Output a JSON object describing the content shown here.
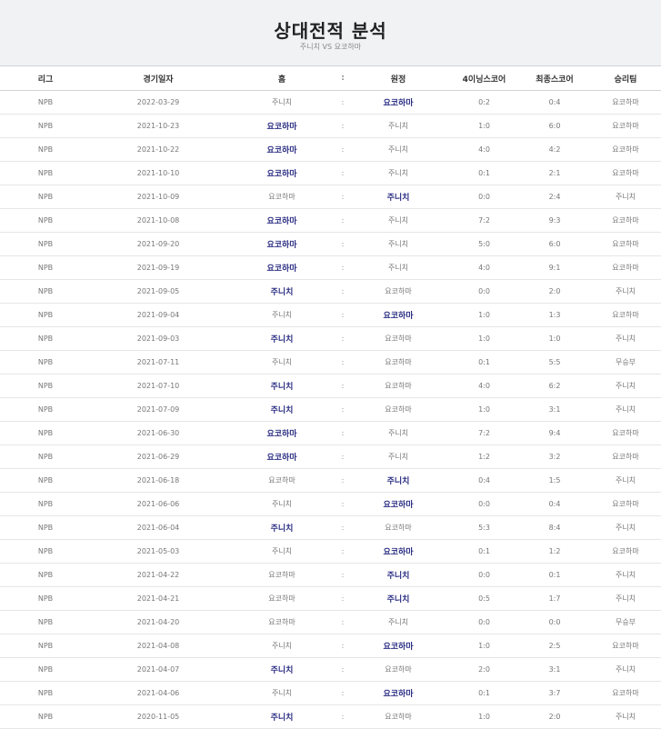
{
  "header": {
    "title": "상대전적 분석",
    "subtitle": "주니치 VS 요코하마"
  },
  "table": {
    "columns": [
      "리그",
      "경기일자",
      "홈",
      ":",
      "원정",
      "4이닝스코어",
      "최종스코어",
      "승리팀"
    ],
    "rows": [
      {
        "league": "NPB",
        "date": "2022-03-29",
        "home": "주니치",
        "sep": ":",
        "away": "요코하마",
        "inn4": "0:2",
        "final": "0:4",
        "winner": "요코하마",
        "bold": "away"
      },
      {
        "league": "NPB",
        "date": "2021-10-23",
        "home": "요코하마",
        "sep": ":",
        "away": "주니치",
        "inn4": "1:0",
        "final": "6:0",
        "winner": "요코하마",
        "bold": "home"
      },
      {
        "league": "NPB",
        "date": "2021-10-22",
        "home": "요코하마",
        "sep": ":",
        "away": "주니치",
        "inn4": "4:0",
        "final": "4:2",
        "winner": "요코하마",
        "bold": "home"
      },
      {
        "league": "NPB",
        "date": "2021-10-10",
        "home": "요코하마",
        "sep": ":",
        "away": "주니치",
        "inn4": "0:1",
        "final": "2:1",
        "winner": "요코하마",
        "bold": "home"
      },
      {
        "league": "NPB",
        "date": "2021-10-09",
        "home": "요코하마",
        "sep": ":",
        "away": "주니치",
        "inn4": "0:0",
        "final": "2:4",
        "winner": "주니치",
        "bold": "away"
      },
      {
        "league": "NPB",
        "date": "2021-10-08",
        "home": "요코하마",
        "sep": ":",
        "away": "주니치",
        "inn4": "7:2",
        "final": "9:3",
        "winner": "요코하마",
        "bold": "home"
      },
      {
        "league": "NPB",
        "date": "2021-09-20",
        "home": "요코하마",
        "sep": ":",
        "away": "주니치",
        "inn4": "5:0",
        "final": "6:0",
        "winner": "요코하마",
        "bold": "home"
      },
      {
        "league": "NPB",
        "date": "2021-09-19",
        "home": "요코하마",
        "sep": ":",
        "away": "주니치",
        "inn4": "4:0",
        "final": "9:1",
        "winner": "요코하마",
        "bold": "home"
      },
      {
        "league": "NPB",
        "date": "2021-09-05",
        "home": "주니치",
        "sep": ":",
        "away": "요코하마",
        "inn4": "0:0",
        "final": "2:0",
        "winner": "주니치",
        "bold": "home"
      },
      {
        "league": "NPB",
        "date": "2021-09-04",
        "home": "주니치",
        "sep": ":",
        "away": "요코하마",
        "inn4": "1:0",
        "final": "1:3",
        "winner": "요코하마",
        "bold": "away"
      },
      {
        "league": "NPB",
        "date": "2021-09-03",
        "home": "주니치",
        "sep": ":",
        "away": "요코하마",
        "inn4": "1:0",
        "final": "1:0",
        "winner": "주니치",
        "bold": "home"
      },
      {
        "league": "NPB",
        "date": "2021-07-11",
        "home": "주니치",
        "sep": ":",
        "away": "요코하마",
        "inn4": "0:1",
        "final": "5:5",
        "winner": "무승부",
        "bold": ""
      },
      {
        "league": "NPB",
        "date": "2021-07-10",
        "home": "주니치",
        "sep": ":",
        "away": "요코하마",
        "inn4": "4:0",
        "final": "6:2",
        "winner": "주니치",
        "bold": "home"
      },
      {
        "league": "NPB",
        "date": "2021-07-09",
        "home": "주니치",
        "sep": ":",
        "away": "요코하마",
        "inn4": "1:0",
        "final": "3:1",
        "winner": "주니치",
        "bold": "home"
      },
      {
        "league": "NPB",
        "date": "2021-06-30",
        "home": "요코하마",
        "sep": ":",
        "away": "주니치",
        "inn4": "7:2",
        "final": "9:4",
        "winner": "요코하마",
        "bold": "home"
      },
      {
        "league": "NPB",
        "date": "2021-06-29",
        "home": "요코하마",
        "sep": ":",
        "away": "주니치",
        "inn4": "1:2",
        "final": "3:2",
        "winner": "요코하마",
        "bold": "home"
      },
      {
        "league": "NPB",
        "date": "2021-06-18",
        "home": "요코하마",
        "sep": ":",
        "away": "주니치",
        "inn4": "0:4",
        "final": "1:5",
        "winner": "주니치",
        "bold": "away"
      },
      {
        "league": "NPB",
        "date": "2021-06-06",
        "home": "주니치",
        "sep": ":",
        "away": "요코하마",
        "inn4": "0:0",
        "final": "0:4",
        "winner": "요코하마",
        "bold": "away"
      },
      {
        "league": "NPB",
        "date": "2021-06-04",
        "home": "주니치",
        "sep": ":",
        "away": "요코하마",
        "inn4": "5:3",
        "final": "8:4",
        "winner": "주니치",
        "bold": "home"
      },
      {
        "league": "NPB",
        "date": "2021-05-03",
        "home": "주니치",
        "sep": ":",
        "away": "요코하마",
        "inn4": "0:1",
        "final": "1:2",
        "winner": "요코하마",
        "bold": "away"
      },
      {
        "league": "NPB",
        "date": "2021-04-22",
        "home": "요코하마",
        "sep": ":",
        "away": "주니치",
        "inn4": "0:0",
        "final": "0:1",
        "winner": "주니치",
        "bold": "away"
      },
      {
        "league": "NPB",
        "date": "2021-04-21",
        "home": "요코하마",
        "sep": ":",
        "away": "주니치",
        "inn4": "0:5",
        "final": "1:7",
        "winner": "주니치",
        "bold": "away"
      },
      {
        "league": "NPB",
        "date": "2021-04-20",
        "home": "요코하마",
        "sep": ":",
        "away": "주니치",
        "inn4": "0:0",
        "final": "0:0",
        "winner": "무승부",
        "bold": ""
      },
      {
        "league": "NPB",
        "date": "2021-04-08",
        "home": "주니치",
        "sep": ":",
        "away": "요코하마",
        "inn4": "1:0",
        "final": "2:5",
        "winner": "요코하마",
        "bold": "away"
      },
      {
        "league": "NPB",
        "date": "2021-04-07",
        "home": "주니치",
        "sep": ":",
        "away": "요코하마",
        "inn4": "2:0",
        "final": "3:1",
        "winner": "주니치",
        "bold": "home"
      },
      {
        "league": "NPB",
        "date": "2021-04-06",
        "home": "주니치",
        "sep": ":",
        "away": "요코하마",
        "inn4": "0:1",
        "final": "3:7",
        "winner": "요코하마",
        "bold": "away"
      },
      {
        "league": "NPB",
        "date": "2020-11-05",
        "home": "주니치",
        "sep": ":",
        "away": "요코하마",
        "inn4": "1:0",
        "final": "2:0",
        "winner": "주니치",
        "bold": "home"
      }
    ]
  }
}
